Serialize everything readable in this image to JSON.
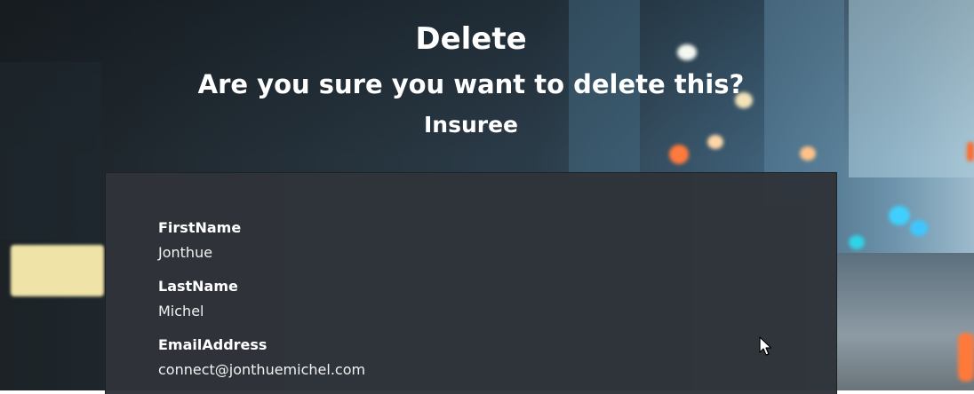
{
  "page": {
    "title": "Delete",
    "confirm_question": "Are you sure you want to delete this?",
    "entity_name": "Insuree"
  },
  "details": {
    "fields": [
      {
        "label": "FirstName",
        "value": "Jonthue"
      },
      {
        "label": "LastName",
        "value": "Michel"
      },
      {
        "label": "EmailAddress",
        "value": "connect@jonthuemichel.com"
      }
    ]
  },
  "theme": {
    "panel_bg": "#2f343a",
    "text_color": "#ffffff"
  },
  "icons": {
    "cursor": "mouse-pointer-icon"
  }
}
